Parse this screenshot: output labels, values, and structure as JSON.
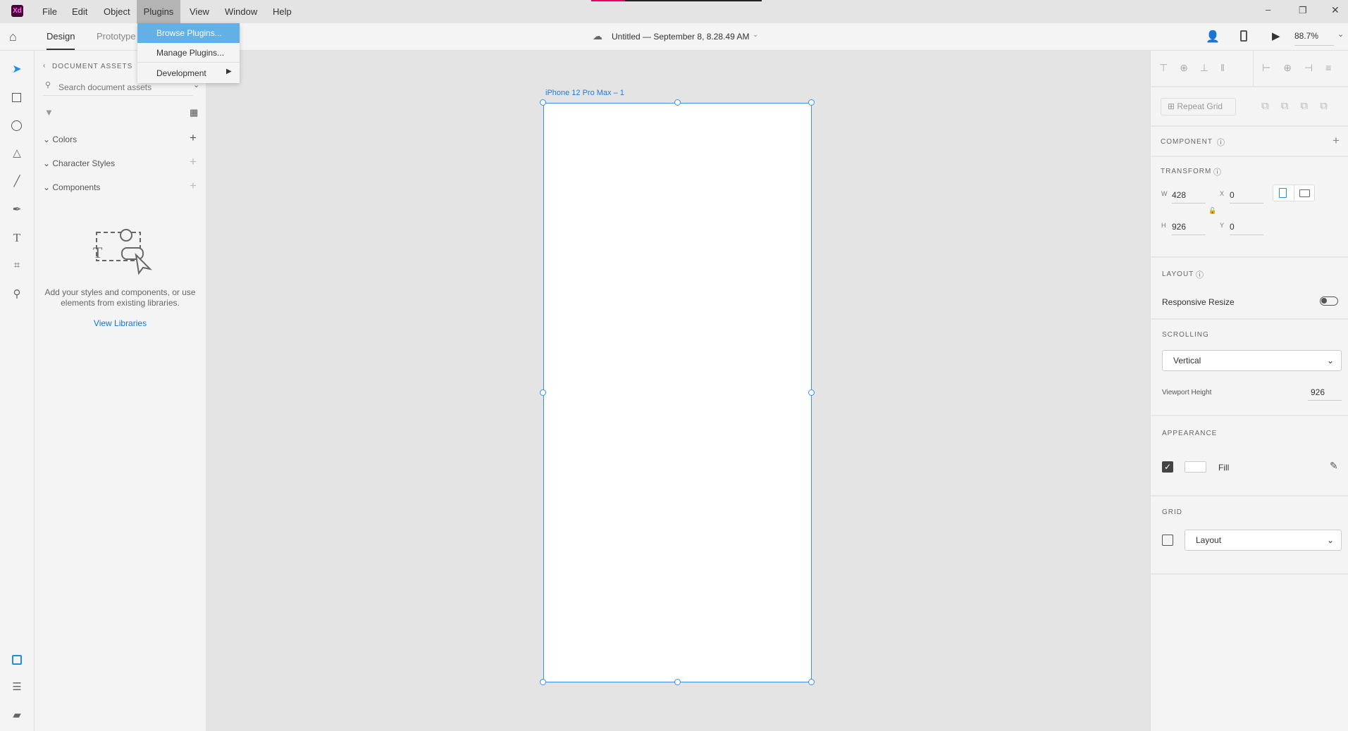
{
  "app": {
    "logo": "Xd",
    "brand_color": "#470137",
    "accent": "#3a8ff0"
  },
  "menubar": {
    "items": [
      "File",
      "Edit",
      "Object",
      "Plugins",
      "View",
      "Window",
      "Help"
    ],
    "active": "Plugins"
  },
  "plugins_menu": {
    "items": [
      "Browse Plugins...",
      "Manage Plugins...",
      "Development"
    ]
  },
  "toolbar": {
    "tabs": [
      "Design",
      "Prototype"
    ],
    "active_tab": "Design",
    "doc_title": "Untitled — September 8, 8.28.49 AM",
    "zoom": "88.7%"
  },
  "window_controls": {
    "minimize": "–",
    "restore": "❐",
    "close": "✕"
  },
  "assets": {
    "title": "DOCUMENT ASSETS",
    "search_placeholder": "Search document assets",
    "sections": [
      "Colors",
      "Character Styles",
      "Components"
    ],
    "empty_text_1": "Add your styles and components, or use",
    "empty_text_2": "elements from existing libraries.",
    "view_libraries": "View Libraries"
  },
  "artboard": {
    "label": "iPhone 12 Pro Max – 1"
  },
  "inspector": {
    "repeat_grid": "Repeat Grid",
    "component": "COMPONENT",
    "transform": "TRANSFORM",
    "w_label": "W",
    "w": "428",
    "h_label": "H",
    "h": "926",
    "x_label": "X",
    "x": "0",
    "y_label": "Y",
    "y": "0",
    "layout": "LAYOUT",
    "responsive_resize": "Responsive Resize",
    "responsive_on": false,
    "scrolling": "SCROLLING",
    "scrolling_value": "Vertical",
    "viewport_label": "Viewport Height",
    "viewport_value": "926",
    "appearance": "APPEARANCE",
    "fill_label": "Fill",
    "fill_checked": true,
    "fill_color": "#ffffff",
    "grid": "GRID",
    "grid_checked": false,
    "grid_value": "Layout"
  }
}
